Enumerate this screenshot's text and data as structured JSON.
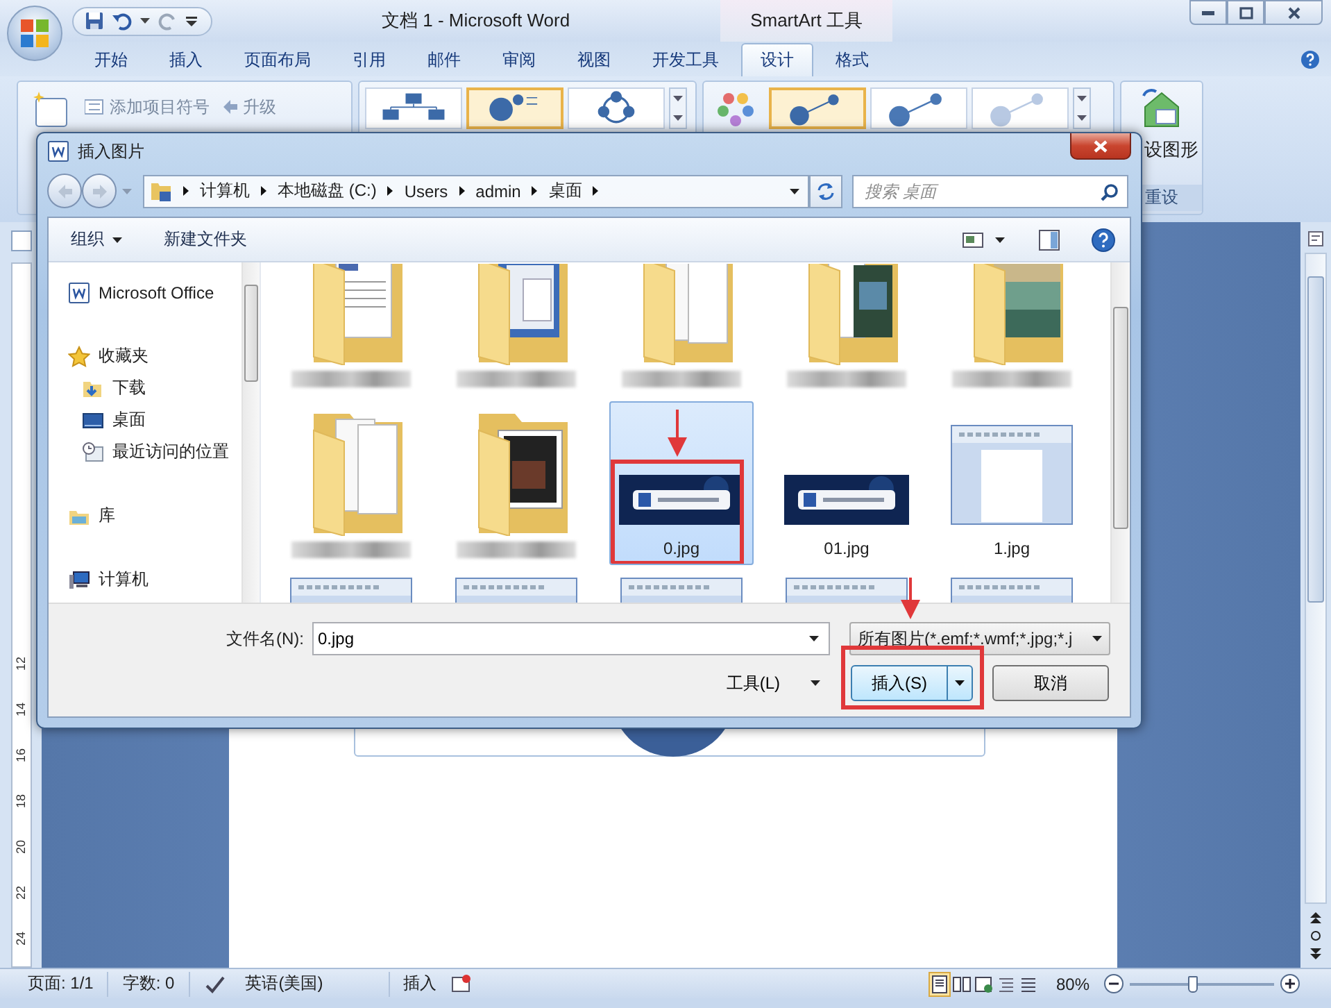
{
  "window": {
    "title": "文档 1 - Microsoft Word",
    "context_tab_group": "SmartArt 工具"
  },
  "ribbon_tabs": [
    {
      "label": "开始",
      "selected": false
    },
    {
      "label": "插入",
      "selected": false
    },
    {
      "label": "页面布局",
      "selected": false
    },
    {
      "label": "引用",
      "selected": false
    },
    {
      "label": "邮件",
      "selected": false
    },
    {
      "label": "审阅",
      "selected": false
    },
    {
      "label": "视图",
      "selected": false
    },
    {
      "label": "开发工具",
      "selected": false
    },
    {
      "label": "设计",
      "selected": true
    },
    {
      "label": "格式",
      "selected": false
    }
  ],
  "ribbon": {
    "add_bullet": "添加项目符号",
    "promote": "升级",
    "layouts": [
      {
        "kind": "hierarchy",
        "selected": false
      },
      {
        "kind": "bullets",
        "selected": true
      },
      {
        "kind": "cycle",
        "selected": false
      }
    ],
    "styles": [
      {
        "kind": "flat",
        "selected": true
      },
      {
        "kind": "shaded",
        "selected": false
      },
      {
        "kind": "light",
        "selected": false
      }
    ],
    "reset_button": "设图形",
    "reset_group": "重设"
  },
  "document": {
    "ruler_numbers": [
      "12",
      "14",
      "16",
      "18",
      "20",
      "22",
      "24"
    ]
  },
  "dialog": {
    "title": "插入图片",
    "breadcrumb": [
      "计算机",
      "本地磁盘 (C:)",
      "Users",
      "admin",
      "桌面"
    ],
    "search": {
      "placeholder": "搜索 桌面"
    },
    "toolbar": {
      "organize": "组织",
      "new_folder": "新建文件夹"
    },
    "nav": [
      {
        "label": "Microsoft Office",
        "kind": "word"
      },
      {
        "label": "收藏夹",
        "kind": "favorites",
        "children": [
          {
            "label": "下载",
            "kind": "downloads"
          },
          {
            "label": "桌面",
            "kind": "desktop"
          },
          {
            "label": "最近访问的位置",
            "kind": "recent"
          }
        ]
      },
      {
        "label": "库",
        "kind": "library"
      },
      {
        "label": "计算机",
        "kind": "computer"
      }
    ],
    "files": [
      {
        "kind": "folder_document",
        "label_blurred": true,
        "selected": false
      },
      {
        "kind": "folder_window",
        "label_blurred": true,
        "selected": false
      },
      {
        "kind": "folder_papers",
        "label_blurred": true,
        "selected": false
      },
      {
        "kind": "folder_photo",
        "label_blurred": true,
        "selected": false
      },
      {
        "kind": "folder_landscape",
        "label_blurred": true,
        "selected": false
      },
      {
        "kind": "folder_papers",
        "label_blurred": true,
        "selected": false
      },
      {
        "kind": "folder_film",
        "label_blurred": true,
        "selected": false
      },
      {
        "kind": "banner_image",
        "name": "0.jpg",
        "selected": true,
        "annotated": true
      },
      {
        "kind": "banner_image",
        "name": "01.jpg",
        "selected": false
      },
      {
        "kind": "document_image",
        "name": "1.jpg",
        "selected": false
      },
      {
        "kind": "document_image",
        "selected": false
      },
      {
        "kind": "document_image",
        "selected": false
      },
      {
        "kind": "document_image",
        "selected": false
      },
      {
        "kind": "document_image",
        "selected": false
      },
      {
        "kind": "document_image",
        "selected": false
      }
    ],
    "filename": {
      "label": "文件名(N):",
      "value": "0.jpg"
    },
    "file_type": "所有图片(*.emf;*.wmf;*.jpg;*.j",
    "tools": "工具(L)",
    "insert": {
      "label": "插入(S)",
      "annotated": true
    },
    "cancel": "取消"
  },
  "status_bar": {
    "page": "页面: 1/1",
    "words": "字数: 0",
    "language": "英语(美国)",
    "mode": "插入",
    "views": [
      {
        "kind": "print_layout",
        "selected": true
      },
      {
        "kind": "reading",
        "selected": false
      },
      {
        "kind": "web",
        "selected": false
      },
      {
        "kind": "outline",
        "selected": false
      },
      {
        "kind": "draft",
        "selected": false
      }
    ],
    "zoom": "80%",
    "zoom_slider": {
      "level": 0.43
    }
  }
}
